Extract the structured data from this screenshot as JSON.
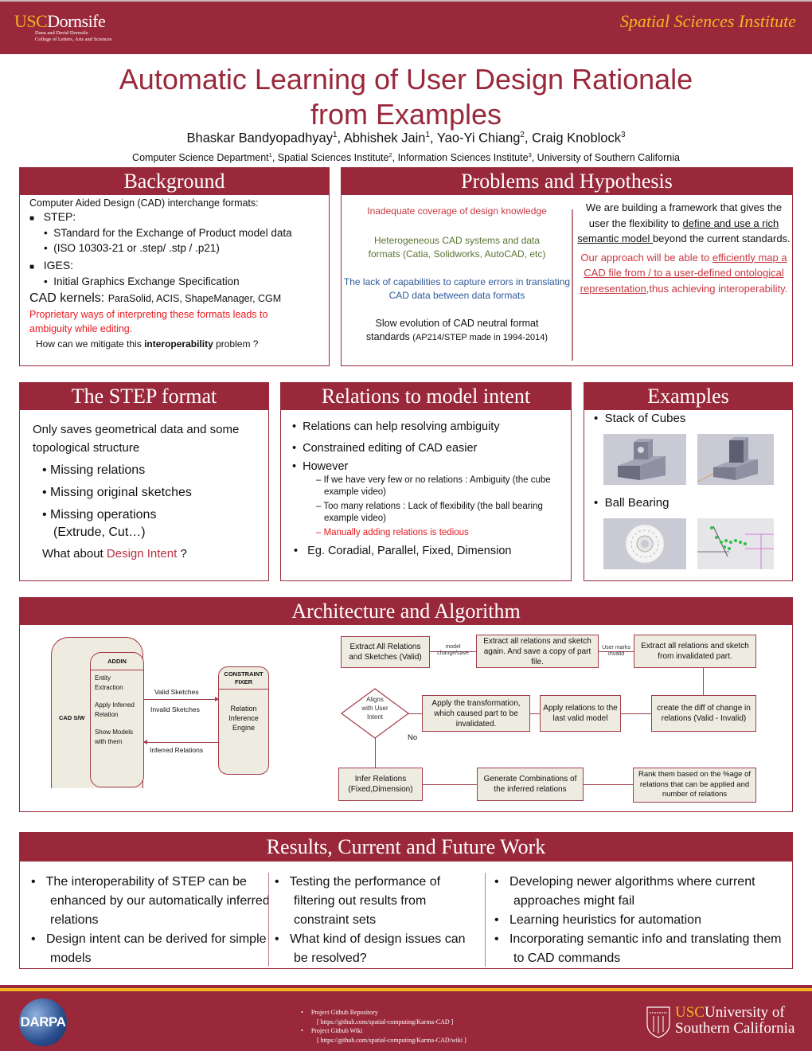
{
  "header": {
    "logo_usc": "USC",
    "logo_dornsife": "Dornsife",
    "logo_sub1": "Dana and David Dornsife",
    "logo_sub2": "College of Letters, Arts and Sciences",
    "institute": "Spatial Sciences Institute"
  },
  "title": {
    "line1": "Automatic Learning of User Design Rationale",
    "line2": "from Examples"
  },
  "authors": [
    {
      "name": "Bhaskar Bandyopadhyay",
      "sup": "1"
    },
    {
      "name": "Abhishek Jain",
      "sup": "1"
    },
    {
      "name": "Yao-Yi Chiang",
      "sup": "2"
    },
    {
      "name": "Craig Knoblock",
      "sup": "3"
    }
  ],
  "affiliations": [
    {
      "name": "Computer Science Department",
      "sup": "1"
    },
    {
      "name": "Spatial Sciences Institute",
      "sup": "2"
    },
    {
      "name": "Information Sciences Institute",
      "sup": "3"
    }
  ],
  "affiliation_tail": ", University of Southern  California",
  "background": {
    "heading": "Background",
    "intro": "Computer Aided Design (CAD) interchange formats:",
    "step_label": "STEP:",
    "step_items": [
      "STandard for the Exchange of Product model data",
      "(ISO 10303-21 or .step/ .stp / .p21)"
    ],
    "iges_label": "IGES:",
    "iges_items": [
      "Initial Graphics Exchange Specification"
    ],
    "kernels_label": "CAD kernels:",
    "kernels_value": "ParaSolid, ACIS, ShapeManager, CGM",
    "warning": "Proprietary ways of interpreting these formats leads to ambiguity while editing.",
    "question_pre": "How can we mitigate this ",
    "question_bold": "interoperability",
    "question_post": " problem ?"
  },
  "problems": {
    "heading": "Problems and Hypothesis",
    "p1": "Inadequate coverage of design knowledge",
    "p2": "Heterogeneous CAD systems and data formats (Catia, Solidworks, AutoCAD, etc)",
    "p3": "The lack of capabilities to capture errors in translating CAD data between data  formats",
    "p4a": "Slow evolution of CAD neutral format",
    "p4b": "standards  ",
    "p4c": "(AP214/STEP made in 1994-2014)",
    "h1a": "We are building a framework that gives  the user the flexibility to ",
    "h1b": "define and  use a rich semantic model ",
    "h1c": "beyond  the current standards.",
    "h2a": "Our approach will be able to ",
    "h2b": "efficiently map a CAD file from / to a user-defined ontological representation",
    "h2c": ",thus achieving interoperability."
  },
  "step_format": {
    "heading": "The STEP format",
    "intro": "Only saves geometrical data  and some topological  structure",
    "items": [
      "Missing relations",
      "Missing original sketches",
      "Missing operations (Extrude, Cut…)"
    ],
    "question_pre": "What about ",
    "question_red": "Design Intent",
    "question_post": " ?"
  },
  "relations": {
    "heading": "Relations to model intent",
    "items": [
      "Relations can help resolving ambiguity",
      "Constrained editing of CAD easier",
      "However"
    ],
    "sub_items": [
      "If we have very few or no relations :  Ambiguity (the cube example video)",
      "Too many relations : Lack of flexibility (the  ball bearing example video)"
    ],
    "sub_red": "Manually adding relations is tedious",
    "last": "Eg. Coradial, Parallel, Fixed, Dimension"
  },
  "examples": {
    "heading": "Examples",
    "item1": "Stack of Cubes",
    "item2": "Ball Bearing"
  },
  "architecture": {
    "heading": "Architecture and Algorithm",
    "cad_sw": "CAD S/W",
    "addin": "ADDIN",
    "addin_items": [
      "Entity Extraction",
      "Apply Inferred Relation",
      "Show Models with them"
    ],
    "constraint_fixer": "CONSTRAINT FIXER",
    "engine": "Relation Inference Engine",
    "valid_sketches": "Valid Sketches",
    "invalid_sketches": "Invalid Sketches",
    "inferred_relations": "Inferred Relations",
    "flow": {
      "b1": "Extract All Relations and Sketches (Valid)",
      "l1": "model change/save",
      "b2": "Extract all relations and sketch again. And save a copy of part file.",
      "l2": "User marks Invalid",
      "b3": "Extract all relations and sketch from invalidated part.",
      "b4": "create the diff of change in relations (Valid - Invalid)",
      "b5": "Apply relations to the last valid model",
      "b6": "Apply the transformation, which caused part to be invalidated.",
      "diamond": "Aligns with User Intent",
      "no": "No",
      "b7": "Infer Relations (Fixed,Dimension)",
      "b8": "Generate Combinations of the inferred relations",
      "b9": "Rank them based on the %age of relations that can be applied and number of relations"
    }
  },
  "results": {
    "heading": "Results, Current and Future Work",
    "col1": [
      "The interoperability of STEP can be enhanced by our automatically inferred relations",
      "Design intent can be derived for simple models"
    ],
    "col2": [
      "Testing the performance of filtering out results from constraint sets",
      "What kind of design issues can be resolved?"
    ],
    "col3": [
      "Developing newer algorithms where current approaches might fail",
      "Learning heuristics for automation",
      "Incorporating semantic info and translating them to CAD commands"
    ]
  },
  "footer": {
    "darpa": "DARPA",
    "link1_label": "Project Github Repository",
    "link1_url": "[ https://github.com/spatial-computing/Karma-CAD ]",
    "link2_label": "Project Github Wiki",
    "link2_url": "[ https://github.com/spatial-computing/Karma-CAD/wiki ]",
    "usc_logo_usc": "USC",
    "usc_logo_univ": "University of",
    "usc_logo_sc": "Southern California"
  },
  "colors": {
    "brand_maroon": "#99283a",
    "brand_gold": "#f4b521"
  }
}
